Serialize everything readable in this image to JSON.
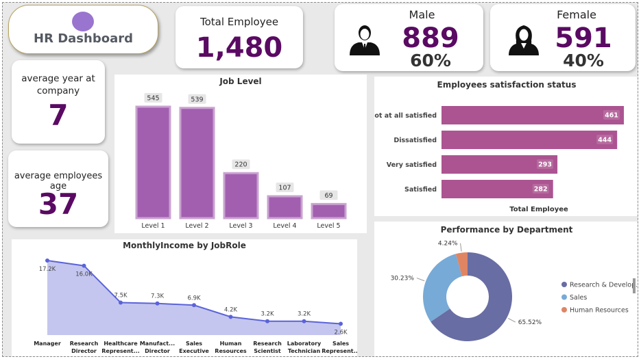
{
  "header": {
    "title": "HR Dashboard"
  },
  "kpis": {
    "total_employee": {
      "label": "Total Employee",
      "value": "1,480"
    },
    "male": {
      "label": "Male",
      "value": "889",
      "percent": "60%",
      "icon": "male-user-icon"
    },
    "female": {
      "label": "Female",
      "value": "591",
      "percent": "40%",
      "icon": "female-user-icon"
    },
    "avg_years": {
      "label_line1": "average year at",
      "label_line2": "company",
      "value": "7"
    },
    "avg_age": {
      "label": "average employees age",
      "value": "37"
    }
  },
  "colors": {
    "accent": "#5a0a63",
    "bar": "#a25fb0",
    "bar_border": "#c9a3d0",
    "hbar": "#ab5491",
    "area_fill": "#c4c6ef",
    "area_line": "#5b63d8",
    "donut_rd": "#686da3",
    "donut_sales": "#77aad6",
    "donut_hr": "#e08563"
  },
  "chart_data": [
    {
      "type": "bar",
      "title": "Job Level",
      "categories": [
        "Level 1",
        "Level 2",
        "Level 3",
        "Level 4",
        "Level 5"
      ],
      "values": [
        545,
        539,
        220,
        107,
        69
      ],
      "data_labels": [
        "545",
        "539",
        "220",
        "107",
        "69"
      ],
      "ylim": [
        0,
        600
      ]
    },
    {
      "type": "bar",
      "orientation": "horizontal",
      "title": "Employees satisfaction status",
      "xlabel": "Total Employee",
      "categories": [
        "Not at all satisfied",
        "Dissatisfied",
        "Very satisfied",
        "Satisfied"
      ],
      "values": [
        461,
        444,
        293,
        282
      ],
      "data_labels": [
        "461",
        "444",
        "293",
        "282"
      ],
      "xlim": [
        0,
        470
      ]
    },
    {
      "type": "area",
      "title": "MonthlyIncome by JobRole",
      "categories": [
        [
          "Manager"
        ],
        [
          "Research",
          "Director"
        ],
        [
          "Healthcare",
          "Represent..."
        ],
        [
          "Manufact...",
          "Director"
        ],
        [
          "Sales",
          "Executive"
        ],
        [
          "Human",
          "Resources"
        ],
        [
          "Research",
          "Scientist"
        ],
        [
          "Laboratory",
          "Technician"
        ],
        [
          "Sales",
          "Represent..."
        ]
      ],
      "values": [
        17.2,
        16.0,
        7.5,
        7.3,
        6.9,
        4.2,
        3.2,
        3.2,
        2.6
      ],
      "data_labels": [
        "17.2K",
        "16.0K",
        "7.5K",
        "7.3K",
        "6.9K",
        "4.2K",
        "3.2K",
        "3.2K",
        "2.6K"
      ],
      "ylim": [
        0,
        18
      ]
    },
    {
      "type": "pie",
      "title": "Performance by Department",
      "donut": true,
      "series": [
        {
          "name": "Research & Develop...",
          "value": 65.52,
          "label": "65.52%"
        },
        {
          "name": "Sales",
          "value": 30.23,
          "label": "30.23%"
        },
        {
          "name": "Human Resources",
          "value": 4.24,
          "label": "4.24%"
        }
      ],
      "legend": "right"
    }
  ]
}
